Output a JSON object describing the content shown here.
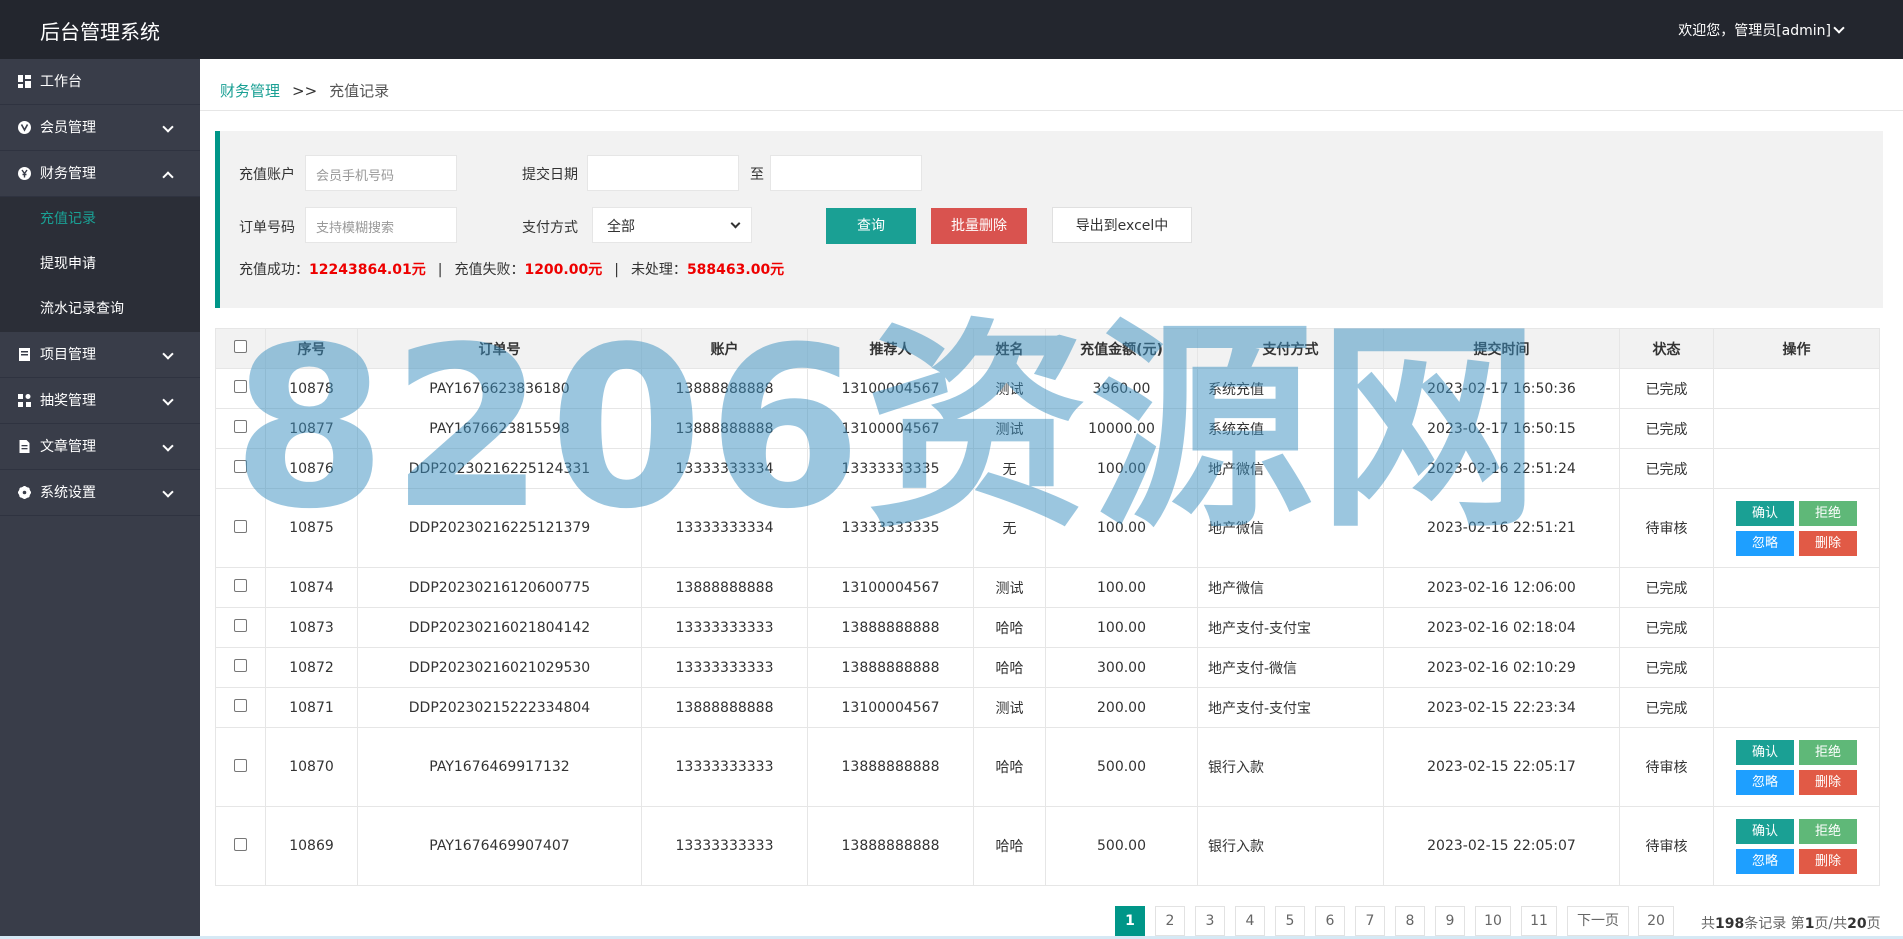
{
  "header": {
    "title": "后台管理系统",
    "user": "欢迎您，管理员[admin]"
  },
  "sidebar": {
    "items": [
      {
        "label": "工作台",
        "icon": "dashboard-icon"
      },
      {
        "label": "会员管理",
        "icon": "vip-icon"
      },
      {
        "label": "财务管理",
        "icon": "yen-icon",
        "expanded": true,
        "children": [
          {
            "label": "充值记录",
            "active": true
          },
          {
            "label": "提现申请"
          },
          {
            "label": "流水记录查询"
          }
        ]
      },
      {
        "label": "项目管理",
        "icon": "book-icon"
      },
      {
        "label": "抽奖管理",
        "icon": "grid-icon"
      },
      {
        "label": "文章管理",
        "icon": "file-icon"
      },
      {
        "label": "系统设置",
        "icon": "gear-icon"
      }
    ]
  },
  "breadcrumb": {
    "parent": "财务管理",
    "sep": ">>",
    "current": "充值记录"
  },
  "filter": {
    "account_label": "充值账户",
    "account_placeholder": "会员手机号码",
    "date_label": "提交日期",
    "date_to": "至",
    "order_label": "订单号码",
    "order_placeholder": "支持模糊搜索",
    "pay_label": "支付方式",
    "pay_value": "全部",
    "query": "查询",
    "batch_delete": "批量删除",
    "export": "导出到excel中",
    "stats": {
      "success_label": "充值成功：",
      "success_value": "12243864.01元",
      "fail_label": "充值失败：",
      "fail_value": "1200.00元",
      "pending_label": "未处理：",
      "pending_value": "588463.00元",
      "pipe": "|"
    }
  },
  "table": {
    "headers": [
      "",
      "序号",
      "订单号",
      "账户",
      "推荐人",
      "姓名",
      "充值金额(元)",
      "支付方式",
      "提交时间",
      "状态",
      "操作"
    ],
    "rows": [
      {
        "id": "10878",
        "order": "PAY1676623836180",
        "account": "13888888888",
        "ref": "13100004567",
        "name": "测试",
        "amount": "3960.00",
        "pay": "系统充值",
        "time": "2023-02-17 16:50:36",
        "status": "已完成",
        "ops": false
      },
      {
        "id": "10877",
        "order": "PAY1676623815598",
        "account": "13888888888",
        "ref": "13100004567",
        "name": "测试",
        "amount": "10000.00",
        "pay": "系统充值",
        "time": "2023-02-17 16:50:15",
        "status": "已完成",
        "ops": false
      },
      {
        "id": "10876",
        "order": "DDP20230216225124331",
        "account": "13333333334",
        "ref": "13333333335",
        "name": "无",
        "amount": "100.00",
        "pay": "地产微信",
        "time": "2023-02-16 22:51:24",
        "status": "已完成",
        "ops": false
      },
      {
        "id": "10875",
        "order": "DDP20230216225121379",
        "account": "13333333334",
        "ref": "13333333335",
        "name": "无",
        "amount": "100.00",
        "pay": "地产微信",
        "time": "2023-02-16 22:51:21",
        "status": "待审核",
        "ops": true
      },
      {
        "id": "10874",
        "order": "DDP20230216120600775",
        "account": "13888888888",
        "ref": "13100004567",
        "name": "测试",
        "amount": "100.00",
        "pay": "地产微信",
        "time": "2023-02-16 12:06:00",
        "status": "已完成",
        "ops": false
      },
      {
        "id": "10873",
        "order": "DDP20230216021804142",
        "account": "13333333333",
        "ref": "13888888888",
        "name": "哈哈",
        "amount": "100.00",
        "pay": "地产支付-支付宝",
        "time": "2023-02-16 02:18:04",
        "status": "已完成",
        "ops": false
      },
      {
        "id": "10872",
        "order": "DDP20230216021029530",
        "account": "13333333333",
        "ref": "13888888888",
        "name": "哈哈",
        "amount": "300.00",
        "pay": "地产支付-微信",
        "time": "2023-02-16 02:10:29",
        "status": "已完成",
        "ops": false
      },
      {
        "id": "10871",
        "order": "DDP20230215222334804",
        "account": "13888888888",
        "ref": "13100004567",
        "name": "测试",
        "amount": "200.00",
        "pay": "地产支付-支付宝",
        "time": "2023-02-15 22:23:34",
        "status": "已完成",
        "ops": false
      },
      {
        "id": "10870",
        "order": "PAY1676469917132",
        "account": "13333333333",
        "ref": "13888888888",
        "name": "哈哈",
        "amount": "500.00",
        "pay": "银行入款",
        "time": "2023-02-15 22:05:17",
        "status": "待审核",
        "ops": true
      },
      {
        "id": "10869",
        "order": "PAY1676469907407",
        "account": "13333333333",
        "ref": "13888888888",
        "name": "哈哈",
        "amount": "500.00",
        "pay": "银行入款",
        "time": "2023-02-15 22:05:07",
        "status": "待审核",
        "ops": true
      }
    ],
    "op_labels": {
      "confirm": "确认",
      "reject": "拒绝",
      "ignore": "忽略",
      "delete": "删除"
    }
  },
  "pagination": {
    "pages": [
      "1",
      "2",
      "3",
      "4",
      "5",
      "6",
      "7",
      "8",
      "9",
      "10",
      "11"
    ],
    "next": "下一页",
    "last": "20",
    "info_prefix": "共",
    "total": "198",
    "info_mid": "条记录 第",
    "current": "1",
    "info_mid2": "页/共",
    "pages_total": "20",
    "info_suffix": "页"
  },
  "watermark": "8206资源网"
}
